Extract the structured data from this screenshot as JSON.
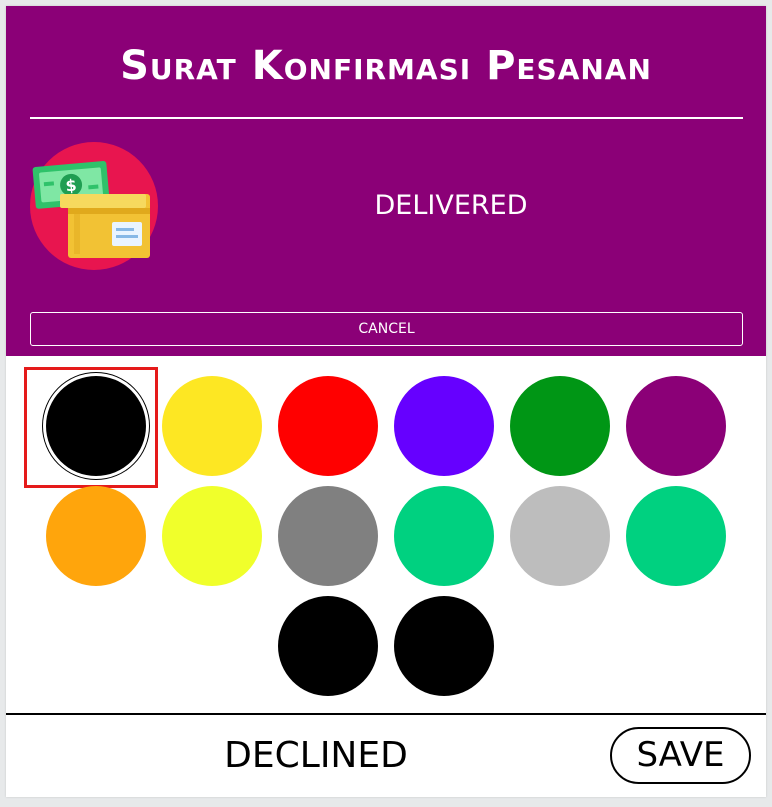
{
  "dialog": {
    "title": "Surat Konfirmasi Pesanan",
    "status_label": "DELIVERED",
    "status_icon": "money-box-delivery-icon",
    "cancel_label": "CANCEL",
    "declined_label": "DECLINED",
    "save_label": "SAVE"
  },
  "colors": {
    "header_background": "#8b0077",
    "selection_frame": "#e51a1a"
  },
  "swatches": [
    {
      "color": "#000000",
      "selected": true
    },
    {
      "color": "#fde723"
    },
    {
      "color": "#ff0000"
    },
    {
      "color": "#6600ff"
    },
    {
      "color": "#009615"
    },
    {
      "color": "#8b0077"
    },
    {
      "color": "#ffa50c"
    },
    {
      "color": "#f0ff2b"
    },
    {
      "color": "#808080"
    },
    {
      "color": "#00d180"
    },
    {
      "color": "#bdbdbd"
    },
    {
      "color": "#00d180"
    },
    {
      "color": "#000000"
    },
    {
      "color": "#000000"
    }
  ]
}
